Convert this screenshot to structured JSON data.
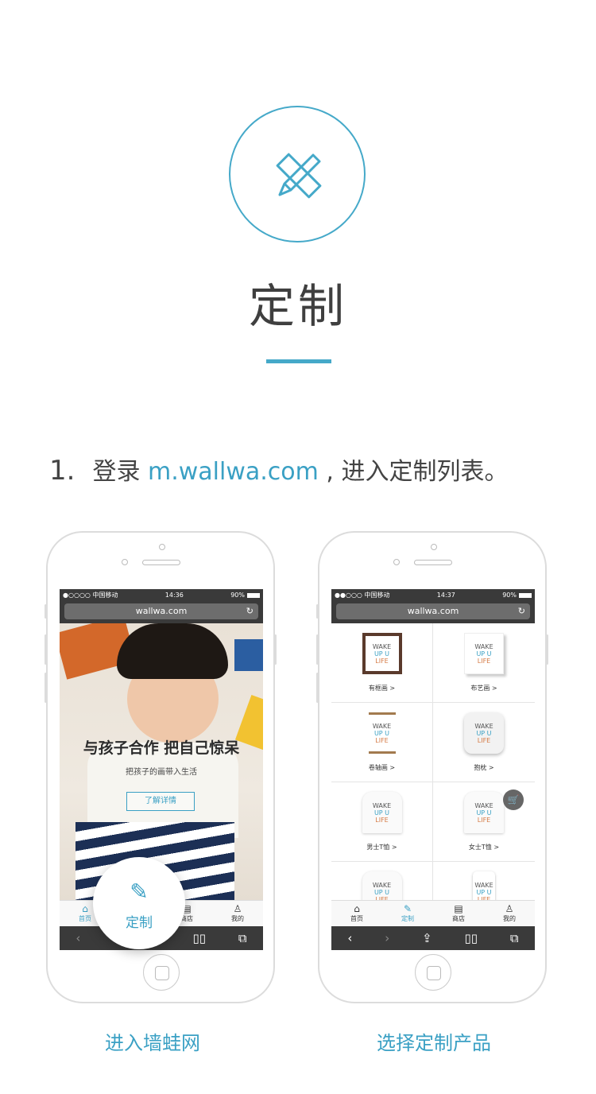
{
  "section": {
    "title": "定制",
    "icon": "pencil-ruler-icon",
    "accent_color": "#45a9c9"
  },
  "step": {
    "number": "1.",
    "prefix": "登录",
    "url": "m.wallwa.com",
    "suffix": " , 进入定制列表。"
  },
  "phone_left": {
    "status": {
      "carrier": "●○○○○ 中国移动 ",
      "time": "14:36",
      "battery": "90%"
    },
    "url": "wallwa.com",
    "hero": {
      "headline": "与孩子合作  把自己惊呆",
      "subtitle": "把孩子的画带入生活",
      "button": "了解详情"
    },
    "tabs": [
      {
        "icon": "⌂",
        "label": "首页"
      },
      {
        "icon": "✎",
        "label": "定制"
      },
      {
        "icon": "▤",
        "label": "商店"
      },
      {
        "icon": "♙",
        "label": "我的"
      }
    ],
    "fab": {
      "icon": "✎",
      "label": "定制"
    },
    "caption": "进入墙蛙网"
  },
  "phone_right": {
    "status": {
      "carrier": "●●○○○ 中国移动 ",
      "time": "14:37",
      "battery": "90%"
    },
    "url": "wallwa.com",
    "thumb_text": [
      "WAKE",
      "UP U",
      "LIFE"
    ],
    "products": [
      {
        "label": "有框画 >",
        "style": "framed"
      },
      {
        "label": "布艺画 >",
        "style": "canvas"
      },
      {
        "label": "卷轴画 >",
        "style": "scroll"
      },
      {
        "label": "抱枕 >",
        "style": "pillow"
      },
      {
        "label": "男士T恤 >",
        "style": "tee"
      },
      {
        "label": "女士T恤 >",
        "style": "tee"
      },
      {
        "label": "",
        "style": "tee"
      },
      {
        "label": "",
        "style": "phonecase"
      }
    ],
    "tabs": [
      {
        "icon": "⌂",
        "label": "首页"
      },
      {
        "icon": "✎",
        "label": "定制"
      },
      {
        "icon": "▤",
        "label": "商店"
      },
      {
        "icon": "♙",
        "label": "我的"
      }
    ],
    "cart_icon": "cart-icon",
    "caption": "选择定制产品"
  }
}
